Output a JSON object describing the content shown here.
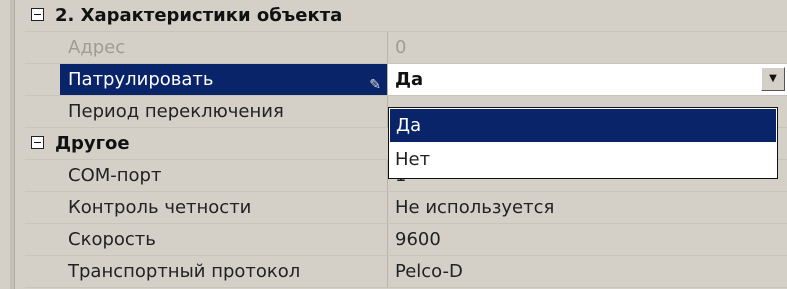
{
  "section1": {
    "title": "2. Характеристики объекта"
  },
  "rows1": [
    {
      "name": "Адрес",
      "value": "0"
    },
    {
      "name": "Патрулировать",
      "value": "Да"
    },
    {
      "name": "Период переключения",
      "value": ""
    }
  ],
  "section2": {
    "title": "Другое"
  },
  "rows2": [
    {
      "name": "COM-порт",
      "value": "1"
    },
    {
      "name": "Контроль четности",
      "value": "Не используется"
    },
    {
      "name": "Скорость",
      "value": "9600"
    },
    {
      "name": "Транспортный протокол",
      "value": "Pelco-D"
    }
  ],
  "dropdown": {
    "options": [
      "Да",
      "Нет"
    ],
    "selected": "Да"
  },
  "icons": {
    "collapse": "collapse-minus-icon",
    "edit": "pencil-icon",
    "dropdown": "chevron-down-icon"
  },
  "colors": {
    "selection": "#0a246a",
    "grid": "#d4d0c8"
  }
}
